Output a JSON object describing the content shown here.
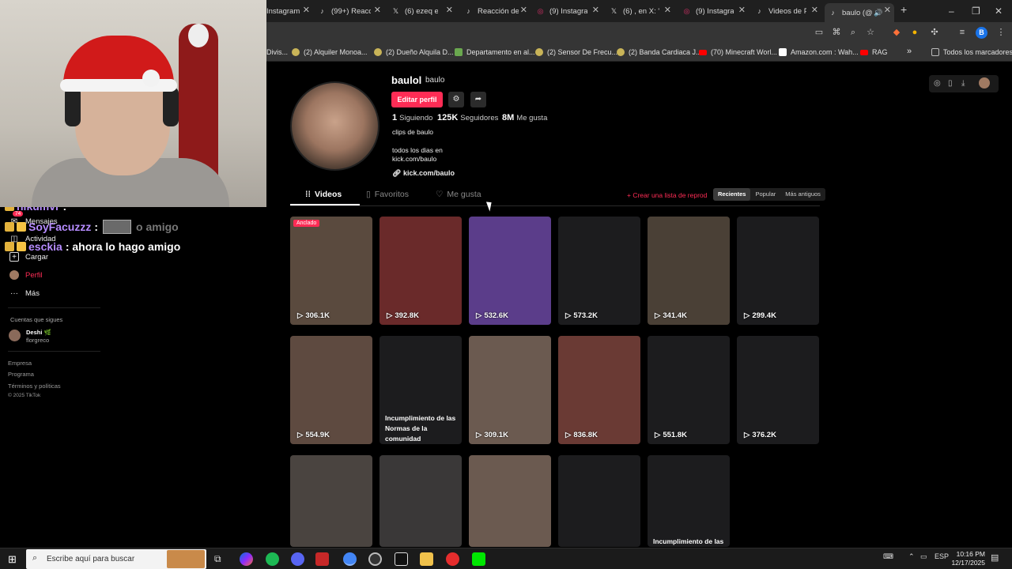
{
  "browser": {
    "tabs": [
      {
        "label": "Instagram",
        "icon": "instagram-icon",
        "color": "#e1306c"
      },
      {
        "label": "(99+) Reacción",
        "icon": "tiktok-icon",
        "color": "#ffffff"
      },
      {
        "label": "(6) ezeq en X",
        "icon": "x-icon",
        "color": "#ffffff"
      },
      {
        "label": "Reacción de",
        "icon": "tiktok-icon",
        "color": "#ffffff"
      },
      {
        "label": "(9) Instagram",
        "icon": "instagram-icon",
        "color": "#e1306c"
      },
      {
        "label": "(6) , en X: \"h",
        "icon": "x-icon",
        "color": "#ffffff"
      },
      {
        "label": "(9) Instagram",
        "icon": "instagram-icon",
        "color": "#e1306c"
      },
      {
        "label": "Videos de P",
        "icon": "tiktok-icon",
        "color": "#ffffff"
      },
      {
        "label": "baulo (@",
        "icon": "tiktok-icon",
        "color": "#ffffff"
      }
    ],
    "new_tab": "+",
    "window_controls": [
      "–",
      "❐",
      "✕"
    ],
    "profile_initial": "B",
    "bookmarks": [
      {
        "label": "Divis...",
        "color": "#888888"
      },
      {
        "label": "(2) Alquiler Monoa...",
        "color": "#c9b458"
      },
      {
        "label": "(2) Dueño Alquila D...",
        "color": "#c9b458"
      },
      {
        "label": "Departamento en al...",
        "color": "#6aa84f"
      },
      {
        "label": "(2) Sensor De Frecu...",
        "color": "#c9b458"
      },
      {
        "label": "(2) Banda Cardiaca J...",
        "color": "#c9b458"
      },
      {
        "label": "(70) Minecraft Worl...",
        "color": "#ff0000"
      },
      {
        "label": "Amazon.com : Wah...",
        "color": "#ffffff"
      },
      {
        "label": "RAG",
        "color": "#ff0000"
      },
      {
        "label": "»",
        "color": "#353535"
      },
      {
        "label": "Todos los marcadores",
        "color": "#888888"
      }
    ]
  },
  "sidebar": {
    "mensajes": "Mensajes",
    "actividad": "Actividad",
    "badge": "74",
    "cargar": "Cargar",
    "perfil": "Perfil",
    "mas": "Más",
    "following_heading": "Cuentas que sigues",
    "following": [
      {
        "name": "Deshi 🌿",
        "handle": "florgreco"
      }
    ],
    "footer": [
      "Empresa",
      "Programa",
      "Términos y políticas",
      "© 2025 TikTok"
    ]
  },
  "chat": [
    {
      "user": "hikumvr",
      "msg": ":"
    },
    {
      "user": "SoyFacuzzz",
      "msg": ":",
      "ghost": "o amigo"
    },
    {
      "user": "esckia",
      "msg": ": ahora lo hago amigo"
    }
  ],
  "profile": {
    "username": "baulol",
    "nickname": "baulo",
    "edit_label": "Editar perfil",
    "following_count": "1",
    "following_label": "Siguiendo",
    "followers_count": "125K",
    "followers_label": "Seguidores",
    "likes_count": "8M",
    "likes_label": "Me gusta",
    "bio_title": "clips de baulo",
    "bio_line1": "todos los dias en",
    "bio_line2": "kick.com/baulo",
    "link": "kick.com/baulo"
  },
  "tabs": {
    "videos": "Videos",
    "favoritos": "Favoritos",
    "me_gusta": "Me gusta",
    "create_list": "+ Crear una lista de reprod",
    "sort": [
      "Recientes",
      "Popular",
      "Más antiguos"
    ]
  },
  "videos": [
    {
      "views": "306.1K",
      "pinned": "Anclado",
      "bg": "#5a4a3e"
    },
    {
      "views": "392.8K",
      "bg": "#6a2a2a"
    },
    {
      "views": "532.6K",
      "bg": "#5b3d8a"
    },
    {
      "views": "573.2K",
      "bg": "#1c1c1e"
    },
    {
      "views": "341.4K",
      "bg": "#4a4036"
    },
    {
      "views": "299.4K",
      "bg": "#1c1c1e"
    },
    {
      "views": "554.9K",
      "bg": "#5e4a40"
    },
    {
      "views": "",
      "blocked": "Incumplimiento de las Normas de la comunidad",
      "bg": "#1c1c1e"
    },
    {
      "views": "309.1K",
      "bg": "#6b5a50"
    },
    {
      "views": "836.8K",
      "bg": "#6a3a34"
    },
    {
      "views": "551.8K",
      "bg": "#1c1c1e"
    },
    {
      "views": "376.2K",
      "bg": "#1c1c1e"
    },
    {
      "views": "",
      "bg": "#4a4440"
    },
    {
      "views": "",
      "bg": "#3a3838"
    },
    {
      "views": "",
      "bg": "#6b5a50"
    },
    {
      "views": "",
      "bg": "#1c1c1e"
    },
    {
      "views": "",
      "blocked": "Incumplimiento de las",
      "bg": "#1c1c1e"
    }
  ],
  "taskbar": {
    "search_placeholder": "Escribe aquí para buscar",
    "lang": "ESP",
    "time": "10:16 PM",
    "date": "12/17/2025"
  }
}
